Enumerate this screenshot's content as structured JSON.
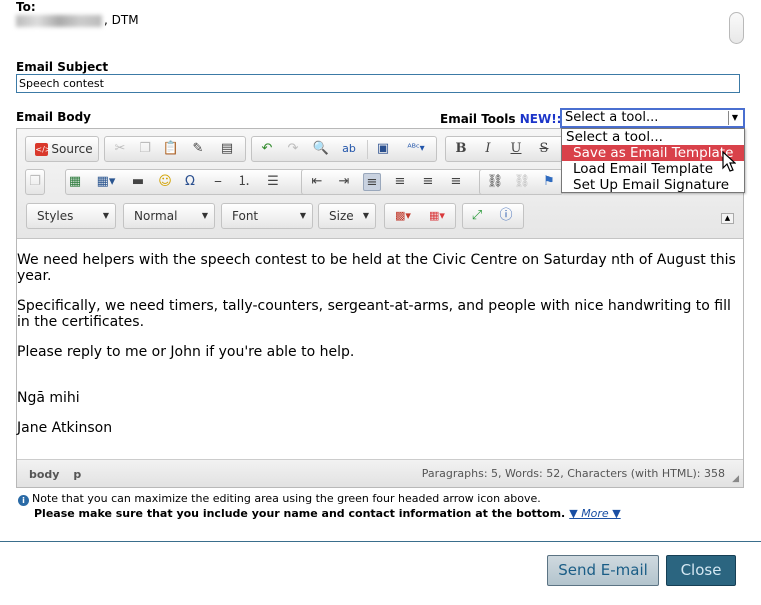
{
  "recipient": {
    "label": "To:",
    "suffix": ", DTM"
  },
  "subject": {
    "label": "Email Subject",
    "value": "Speech contest"
  },
  "body_label": "Email Body",
  "tools": {
    "label": "Email Tools",
    "new_badge": "NEW!:",
    "selected": "Select a tool...",
    "options": [
      "Select a tool...",
      "Save as Email Template",
      "Load Email Template",
      "Set Up Email Signature"
    ],
    "highlighted_index": 1
  },
  "toolbar": {
    "source_label": "Source",
    "styles_label": "Styles",
    "format_label": "Normal",
    "font_label": "Font",
    "size_label": "Size"
  },
  "content": {
    "paragraphs": [
      "We need helpers with the speech contest to be held at the Civic Centre on Saturday nth of August this year.",
      "Specifically, we need timers, tally-counters, sergeant-at-arms, and people with nice handwriting to fill in the certificates.",
      "Please reply to me or John if you're able to help.",
      "Ngā mihi",
      "Jane Atkinson"
    ]
  },
  "statusbar": {
    "path": [
      "body",
      "p"
    ],
    "wordcount": "Paragraphs: 5, Words: 52, Characters (with HTML): 358"
  },
  "notes": {
    "maximize": "Note that you can maximize the editing area using the green four headed arrow icon above.",
    "reminder": "Please make sure that you include your name and contact information at the bottom.",
    "more_link": "▼ More ▼"
  },
  "buttons": {
    "send": "Send E-mail",
    "close": "Close"
  },
  "colors": {
    "accent": "#2b6580",
    "highlight": "#d9414a",
    "new_badge": "#1c35c9"
  }
}
